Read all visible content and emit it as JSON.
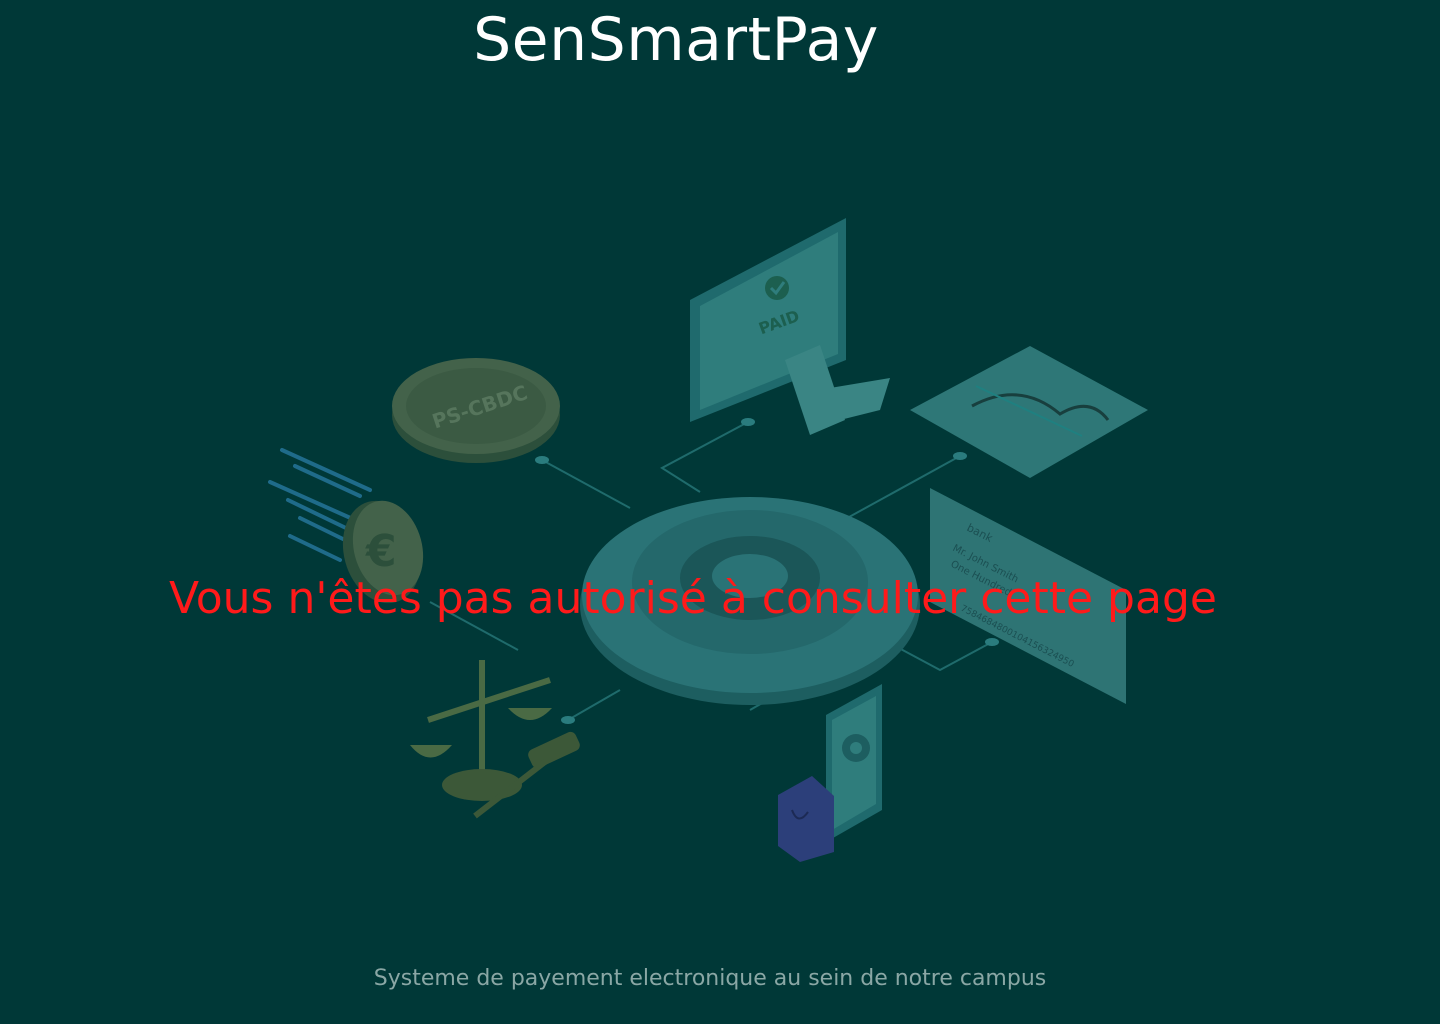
{
  "header": {
    "title": "SenSmartPay"
  },
  "illustration": {
    "monitor_label": "PAID",
    "coin_label": "PS-CBDC",
    "currency_symbol": "€",
    "check_bank": "bank",
    "check_payee": "Mr. John Smith",
    "check_amount_words": "One Hundred",
    "check_micr": "7584684800104156324950"
  },
  "main": {
    "error_message": "Vous n'êtes pas autorisé à consulter cette page"
  },
  "footer": {
    "tagline": "Systeme de payement electronique au sein de notre  campus"
  },
  "colors": {
    "background": "#003837",
    "title": "#ffffff",
    "error": "#ff1a1a",
    "footer_text": "#8aa7a5"
  }
}
